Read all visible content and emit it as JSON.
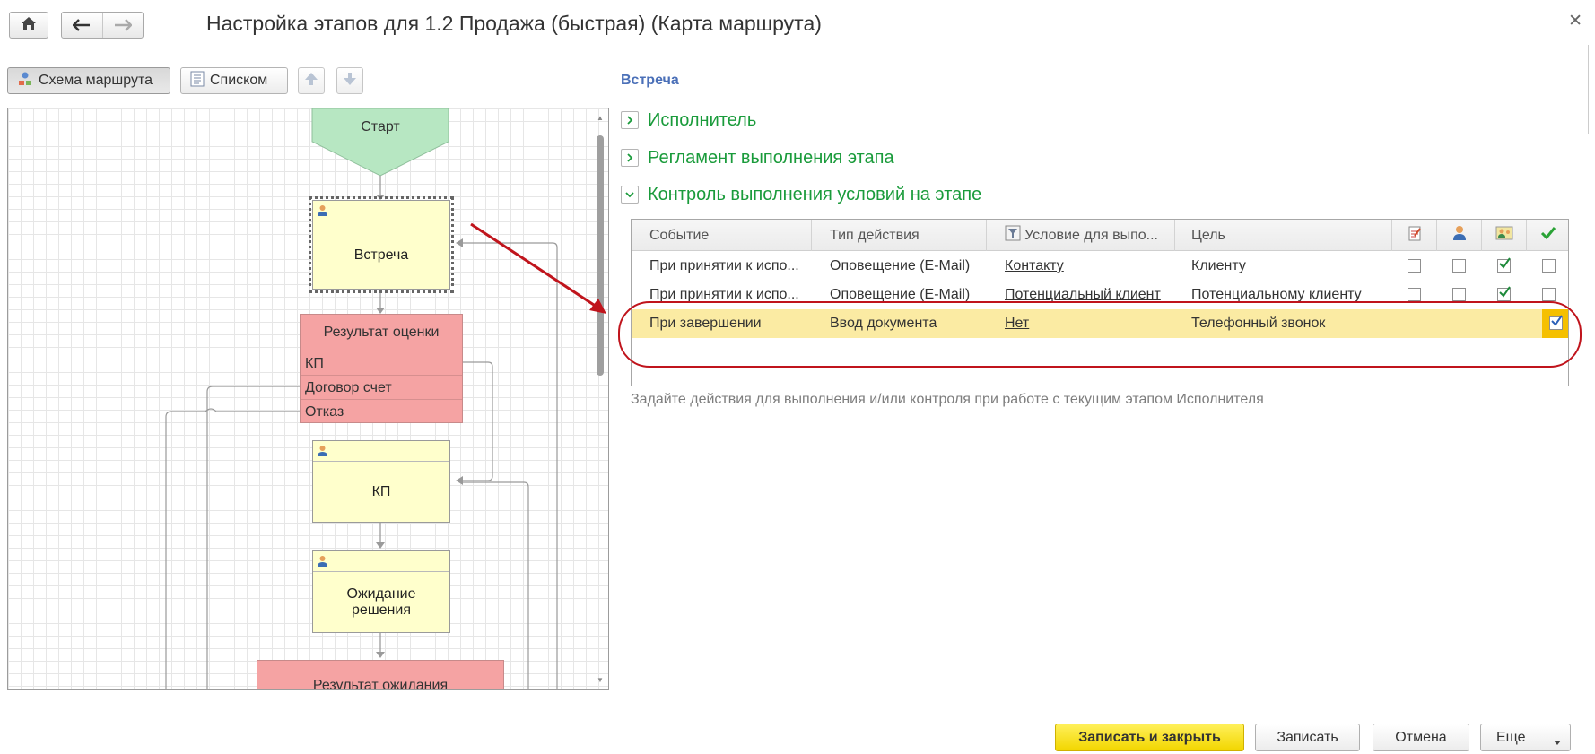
{
  "window": {
    "title": "Настройка этапов для 1.2 Продажа (быстрая) (Карта маршрута)"
  },
  "view": {
    "scheme_label": "Схема маршрута",
    "list_label": "Списком"
  },
  "diagram": {
    "start": "Старт",
    "stage_meeting": "Встреча",
    "condition": {
      "title": "Результат оценки",
      "options": [
        "КП",
        "Договор счет",
        "Отказ"
      ]
    },
    "stage_kp": "КП",
    "stage_wait": "Ожидание решения",
    "condition2": {
      "title": "Результат ожидания"
    }
  },
  "panel": {
    "stage_title": "Встреча",
    "groups": [
      {
        "label": "Исполнитель",
        "expanded": false
      },
      {
        "label": "Регламент выполнения этапа",
        "expanded": false
      },
      {
        "label": "Контроль выполнения условий на этапе",
        "expanded": true
      }
    ],
    "columns": [
      "Событие",
      "Тип действия",
      "Условие для выпо...",
      "Цель"
    ],
    "rows": [
      {
        "event": "При принятии к испо...",
        "action": "Оповещение (E-Mail)",
        "condition": "Контакту",
        "target": "Клиенту",
        "checks": [
          false,
          false,
          true,
          false
        ],
        "selected": false
      },
      {
        "event": "При принятии к испо...",
        "action": "Оповещение (E-Mail)",
        "condition": "Потенциальный клиент",
        "target": "Потенциальному клиенту",
        "checks": [
          false,
          false,
          true,
          false
        ],
        "selected": false
      },
      {
        "event": "При завершении",
        "action": "Ввод документа",
        "condition": "Нет",
        "target": "Телефонный звонок",
        "checks": [
          false,
          false,
          false,
          true
        ],
        "selected": true
      }
    ],
    "hint": "Задайте действия для выполнения и/или контроля при работе с текущим этапом Исполнителя"
  },
  "buttons": {
    "save_close": "Записать и закрыть",
    "save": "Записать",
    "cancel": "Отмена",
    "more": "Еще"
  },
  "colors": {
    "accent_green": "#1a9b3b",
    "stage_title_blue": "#4b70b8",
    "selected_row": "#fbeba3",
    "primary_button": "#f2d600",
    "annotation_red": "#c0141c"
  }
}
